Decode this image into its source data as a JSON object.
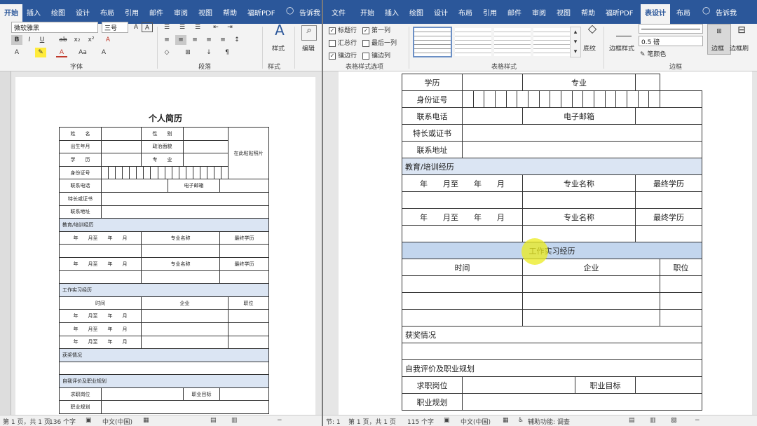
{
  "left": {
    "tabs": [
      "开始",
      "插入",
      "绘图",
      "设计",
      "布局",
      "引用",
      "邮件",
      "审阅",
      "视图",
      "帮助",
      "福昕PDF"
    ],
    "tell_me": "告诉我",
    "font_name": "微软雅黑",
    "font_size": "三号",
    "group_font": "字体",
    "group_paragraph": "段落",
    "group_styles": "样式",
    "styles_btn": "样式",
    "edit_btn": "编辑",
    "doc_title": "个人简历",
    "rows": {
      "name": "姓　　名",
      "gender": "性　　别",
      "photo": "在此粘贴照片",
      "birth": "出生年月",
      "politics": "政治面貌",
      "edu": "学　　历",
      "major": "专　　业",
      "id": "身份证号",
      "phone": "联系电话",
      "email": "电子邮箱",
      "skills": "特长或证书",
      "address": "联系地址",
      "edu_section": "教育/培训经历",
      "period": "年　　月至　　年　　月",
      "major_name": "专业名称",
      "final_edu": "最终学历",
      "work_section": "工作实习经历",
      "time": "时间",
      "company": "企业",
      "position": "职位",
      "ym": "年　　月至　　年　　月",
      "awards": "获奖情况",
      "self_eval": "自我评价及职业规划",
      "job": "求职岗位",
      "goal": "职业目标",
      "plan": "职业规划"
    },
    "status": {
      "page": "第 1 页，共 1 页",
      "words": "136 个字",
      "lang": "中文(中国)"
    }
  },
  "right": {
    "tabs": [
      "文件",
      "开始",
      "插入",
      "绘图",
      "设计",
      "布局",
      "引用",
      "邮件",
      "审阅",
      "视图",
      "帮助",
      "福昕PDF",
      "表设计",
      "布局"
    ],
    "tell_me": "告诉我",
    "options": {
      "header_row": "标题行",
      "first_col": "第一列",
      "total_row": "汇总行",
      "last_col": "最后一列",
      "banded_rows": "镶边行",
      "banded_cols": "镶边列"
    },
    "group_table_style_options": "表格样式选项",
    "group_table_styles": "表格样式",
    "group_borders": "边框",
    "shading": "底纹",
    "border_styles": "边框样式",
    "pen_weight": "0.5 磅",
    "pen_color": "笔颜色",
    "borders_btn": "边框",
    "border_painter": "边框刷",
    "rows": {
      "edu": "学历",
      "major": "专业",
      "id": "身份证号",
      "phone": "联系电话",
      "email": "电子邮箱",
      "skills": "特长或证书",
      "address": "联系地址",
      "edu_section": "教育/培训经历",
      "period": "年　　月至　　年　　月",
      "major_name": "专业名称",
      "final_edu": "最终学历",
      "work_section": "工作实习经历",
      "time": "时间",
      "company": "企业",
      "position": "职位",
      "awards": "获奖情况",
      "self_eval": "自我评价及职业规划",
      "job": "求职岗位",
      "goal": "职业目标",
      "plan": "职业规划"
    },
    "status": {
      "section": "节: 1",
      "page": "第 1 页，共 1 页",
      "words": "115 个字",
      "lang": "中文(中国)",
      "access": "辅助功能: 调查"
    }
  }
}
